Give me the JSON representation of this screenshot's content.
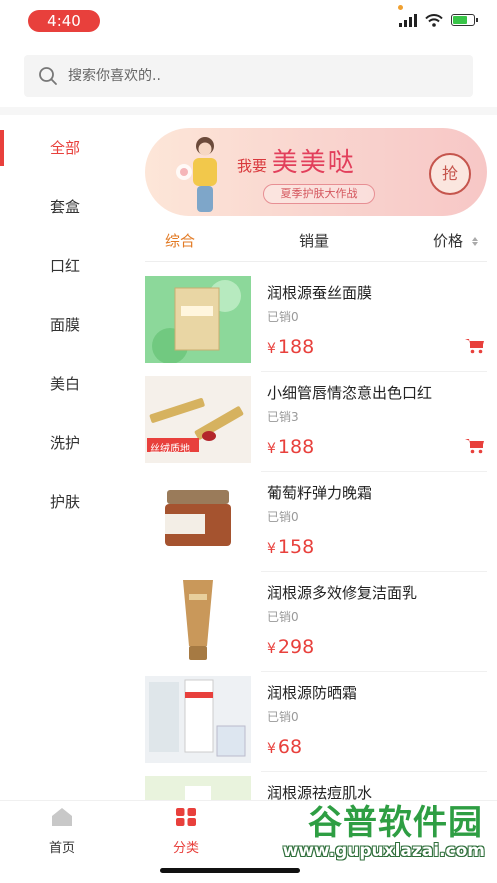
{
  "status_bar": {
    "time": "4:40",
    "battery_percent": 70
  },
  "search": {
    "placeholder": "搜索你喜欢的.."
  },
  "sidebar": {
    "items": [
      {
        "label": "全部",
        "active": true
      },
      {
        "label": "套盒",
        "active": false
      },
      {
        "label": "口红",
        "active": false
      },
      {
        "label": "面膜",
        "active": false
      },
      {
        "label": "美白",
        "active": false
      },
      {
        "label": "洗护",
        "active": false
      },
      {
        "label": "护肤",
        "active": false
      }
    ]
  },
  "banner": {
    "prefix": "我要",
    "title": "美美哒",
    "subtitle": "夏季护肤大作战",
    "button": "抢"
  },
  "sort_tabs": {
    "comprehensive": "综合",
    "sales": "销量",
    "price": "价格"
  },
  "products": [
    {
      "name": "润根源蚕丝面膜",
      "sold": "已销0",
      "currency": "¥",
      "price": "188",
      "thumb": "silk-mask-box",
      "cart": true
    },
    {
      "name": "小细管唇情恣意出色口红",
      "sold": "已销3",
      "currency": "¥",
      "price": "188",
      "thumb": "lipstick",
      "thumb_label": "丝绒质地",
      "cart": true
    },
    {
      "name": "葡萄籽弹力晚霜",
      "sold": "已销0",
      "currency": "¥",
      "price": "158",
      "thumb": "cream-jar",
      "cart": false
    },
    {
      "name": "润根源多效修复洁面乳",
      "sold": "已销0",
      "currency": "¥",
      "price": "298",
      "thumb": "cleanser-tube",
      "cart": false
    },
    {
      "name": "润根源防晒霜",
      "sold": "已销0",
      "currency": "¥",
      "price": "68",
      "thumb": "sunscreen",
      "cart": false
    },
    {
      "name": "润根源祛痘肌水",
      "sold": "",
      "currency": "",
      "price": "",
      "thumb": "acne-toner",
      "cart": false
    }
  ],
  "tabbar": {
    "home": "首页",
    "category": "分类"
  },
  "watermark": {
    "title": "谷普软件园",
    "url": "www.gupuxlazai.com"
  },
  "colors": {
    "accent": "#e8403c",
    "sort_active": "#e27a24",
    "watermark": "#2e9e43"
  }
}
